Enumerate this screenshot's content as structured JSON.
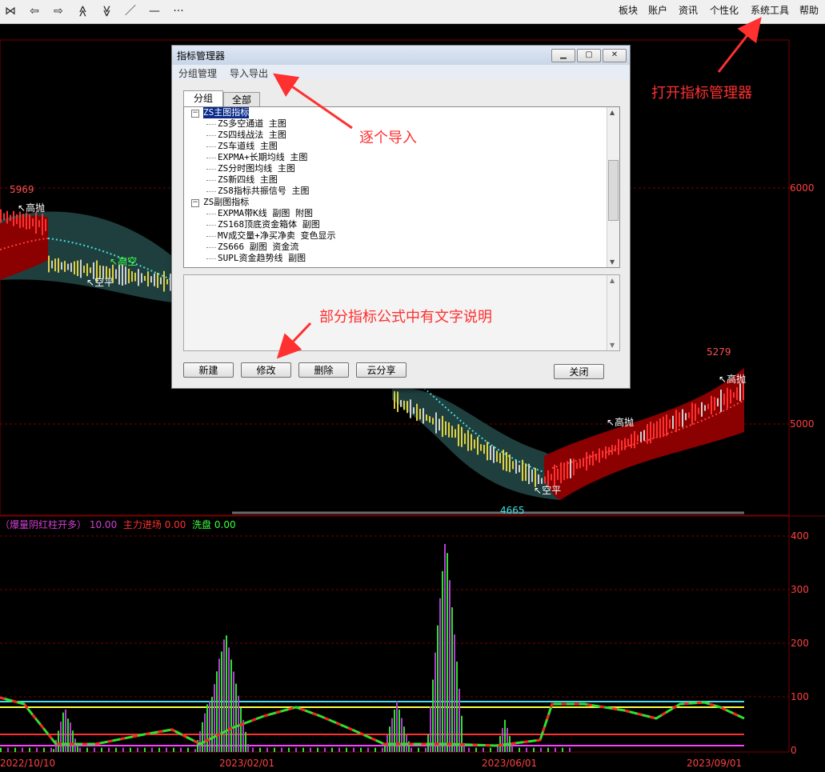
{
  "toolbar": {
    "icons": [
      {
        "name": "first-icon",
        "glyph": "⋈"
      },
      {
        "name": "back-icon",
        "glyph": "⇦"
      },
      {
        "name": "forward-icon",
        "glyph": "⇨"
      },
      {
        "name": "zoom-in-icon",
        "glyph": "≪"
      },
      {
        "name": "zoom-out-icon",
        "glyph": "≫"
      },
      {
        "name": "draw-line-icon",
        "glyph": "／"
      },
      {
        "name": "hline-icon",
        "glyph": "—"
      },
      {
        "name": "more-icon",
        "glyph": "···"
      }
    ],
    "menu": [
      "板块",
      "账户",
      "资讯",
      "个性化",
      "系统工具",
      "帮助"
    ]
  },
  "dialog": {
    "title": "指标管理器",
    "menu": [
      "分组管理",
      "导入导出"
    ],
    "tabs": [
      "分组",
      "全部"
    ],
    "tree": {
      "group1": "ZS主图指标",
      "group1_items": [
        "ZS多空通道 主图",
        "ZS四线战法 主图",
        "ZS车道线 主图",
        "EXPMA+长期均线 主图",
        "ZS分时图均线 主图",
        "ZS新四线 主图",
        "ZS8指标共振信号 主图"
      ],
      "group2": "ZS副图指标",
      "group2_items": [
        "EXPMA带K线 副图 附图",
        "ZS168顶底资金箱体 副图",
        "MV成交量+净买净卖 变色显示",
        "ZS666 副图 资金流",
        "SUPL资金趋势线 副图"
      ]
    },
    "buttons": [
      "新建",
      "修改",
      "删除",
      "云分享"
    ],
    "close_button": "关闭"
  },
  "chart": {
    "price_axis": [
      "6000",
      "5000"
    ],
    "labels": {
      "high1": "5969",
      "high2": "5279",
      "low": "4665",
      "sig_gaopao": "高抛",
      "sig_gaokong": "高空",
      "sig_kongping": "空平"
    },
    "indicator_legend": {
      "name": "（爆量阴红柱开多）",
      "name_value": "10.00",
      "main_label": "主力进场",
      "main_value": "0.00",
      "wash_label": "洗盘",
      "wash_value": "0.00"
    },
    "indicator_axis": [
      "400",
      "300",
      "200",
      "100",
      "0"
    ],
    "date_axis": [
      "2022/10/10",
      "2023/02/01",
      "2023/06/01",
      "2023/09/01"
    ]
  },
  "annotations": {
    "open_manager": "打开指标管理器",
    "import_each": "逐个导入",
    "formula_note": "部分指标公式中有文字说明"
  },
  "colors": {
    "accent_red": "#ff3030",
    "band_red": "#8b0000",
    "band_teal": "#1f3f3f",
    "grid_red": "#7a0000"
  }
}
